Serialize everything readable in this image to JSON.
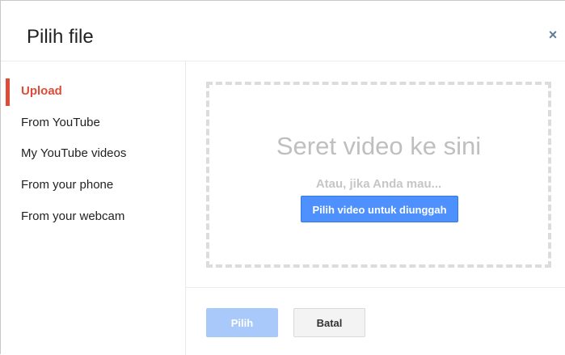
{
  "dialog": {
    "title": "Pilih file",
    "close_glyph": "×"
  },
  "sidebar": {
    "items": [
      {
        "label": "Upload",
        "active": true
      },
      {
        "label": "From YouTube",
        "active": false
      },
      {
        "label": "My YouTube videos",
        "active": false
      },
      {
        "label": "From your phone",
        "active": false
      },
      {
        "label": "From your webcam",
        "active": false
      }
    ]
  },
  "dropzone": {
    "title": "Seret video ke sini",
    "subtitle": "Atau, jika Anda mau...",
    "button_label": "Pilih video untuk diunggah"
  },
  "footer": {
    "select_label": "Pilih",
    "cancel_label": "Batal"
  },
  "colors": {
    "accent_active": "#dd4b39",
    "primary_button": "#4d90fe",
    "disabled_button": "#a9c9fb",
    "close_icon": "#5f7d99"
  },
  "icons": {
    "close": "close-icon"
  }
}
